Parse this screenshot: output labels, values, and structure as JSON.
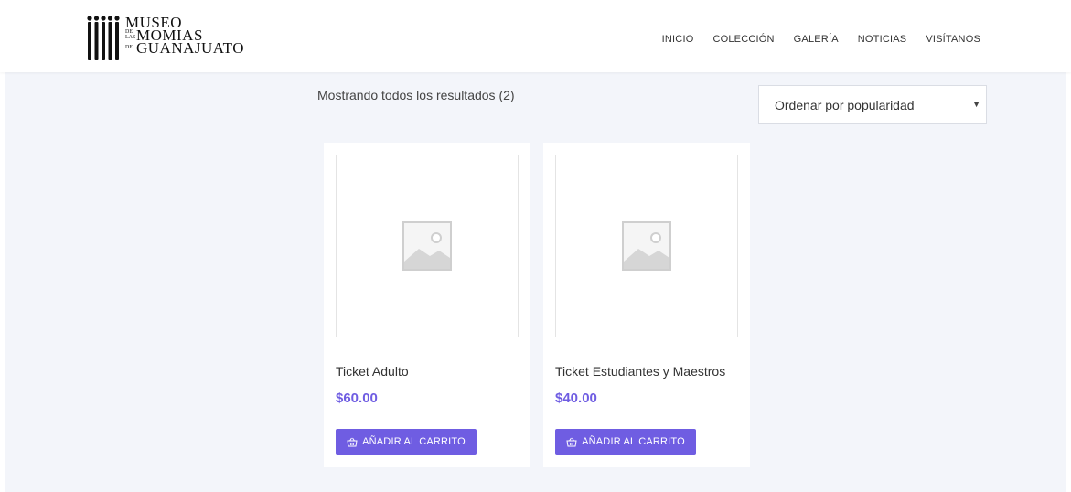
{
  "logo": {
    "line1": "MUSEO",
    "line2_small": "DE LAS",
    "line2": "MOMIAS",
    "line3_small": "DE",
    "line3": "GUANAJUATO"
  },
  "nav": {
    "items": [
      "INICIO",
      "COLECCIÓN",
      "GALERÍA",
      "NOTICIAS",
      "VISÍTANOS"
    ]
  },
  "shop": {
    "result_count": "Mostrando todos los resultados (2)",
    "orderby_selected": "Ordenar por popularidad",
    "products": [
      {
        "title": "Ticket Adulto",
        "price": "$60.00",
        "button": "AÑADIR AL CARRITO"
      },
      {
        "title": "Ticket Estudiantes y Maestros",
        "price": "$40.00",
        "button": "AÑADIR AL CARRITO"
      }
    ]
  },
  "colors": {
    "accent": "#6f5de2",
    "background": "#f3f5fa"
  },
  "icons": {
    "logo": "mummy-figures-logo-icon",
    "product_image": "image-placeholder-icon",
    "button": "basket-icon",
    "select": "caret-down-icon"
  }
}
